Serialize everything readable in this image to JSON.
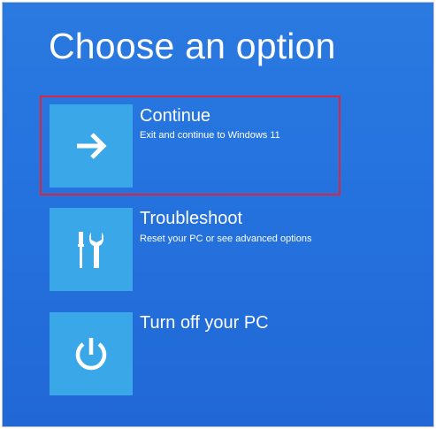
{
  "page": {
    "title": "Choose an option"
  },
  "options": [
    {
      "title": "Continue",
      "description": "Exit and continue to Windows 11",
      "icon": "arrow-right-icon",
      "highlighted": true
    },
    {
      "title": "Troubleshoot",
      "description": "Reset your PC or see advanced options",
      "icon": "tools-icon",
      "highlighted": false
    },
    {
      "title": "Turn off your PC",
      "description": "",
      "icon": "power-icon",
      "highlighted": false
    }
  ],
  "colors": {
    "background": "#2573df",
    "tile": "#39a7e8",
    "text": "#ffffff",
    "highlight": "#e0243a"
  }
}
